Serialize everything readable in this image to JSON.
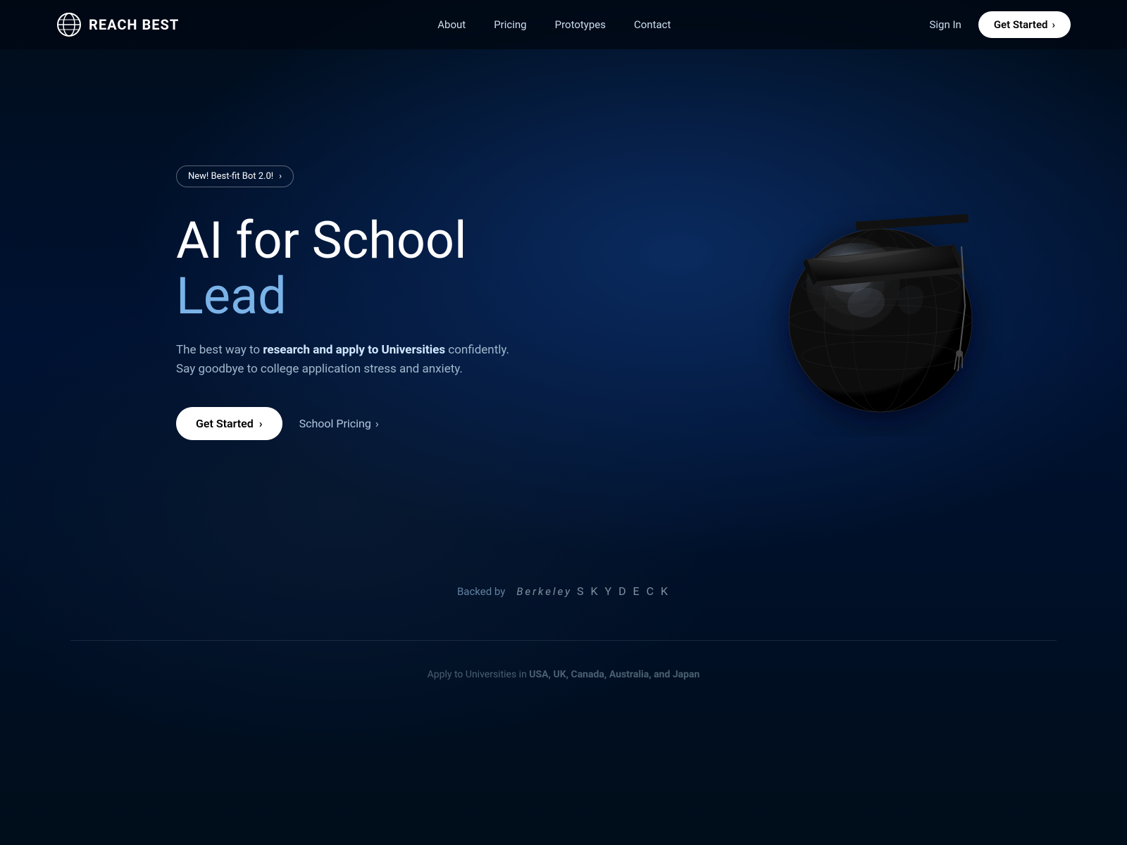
{
  "brand": {
    "name": "REACH BEST",
    "icon_label": "globe-icon"
  },
  "nav": {
    "links": [
      {
        "label": "About",
        "id": "nav-about"
      },
      {
        "label": "Pricing",
        "id": "nav-pricing"
      },
      {
        "label": "Prototypes",
        "id": "nav-prototypes"
      },
      {
        "label": "Contact",
        "id": "nav-contact"
      }
    ],
    "sign_in_label": "Sign In",
    "get_started_label": "Get Started",
    "get_started_arrow": "›"
  },
  "hero": {
    "badge_label": "New! Best-fit Bot 2.0!",
    "badge_arrow": "›",
    "title_line1": "AI for School Lead",
    "title_highlight": "Lead",
    "title_plain": "AI for School ",
    "subtitle_plain_before": "The best way to ",
    "subtitle_bold": "research and apply to Universities",
    "subtitle_plain_after": " confidently.",
    "subtitle_line2": "Say goodbye to college application stress and anxiety.",
    "get_started_label": "Get Started",
    "get_started_arrow": "›",
    "school_pricing_label": "School Pricing",
    "school_pricing_arrow": "›"
  },
  "backed": {
    "prefix": "Backed by",
    "logo_berkeley": "Berkeley",
    "logo_skydeck": "S K Y D E C K"
  },
  "footer": {
    "apply_text": "Apply to Universities in ",
    "countries": "USA, UK, Canada, Australia, and Japan"
  }
}
